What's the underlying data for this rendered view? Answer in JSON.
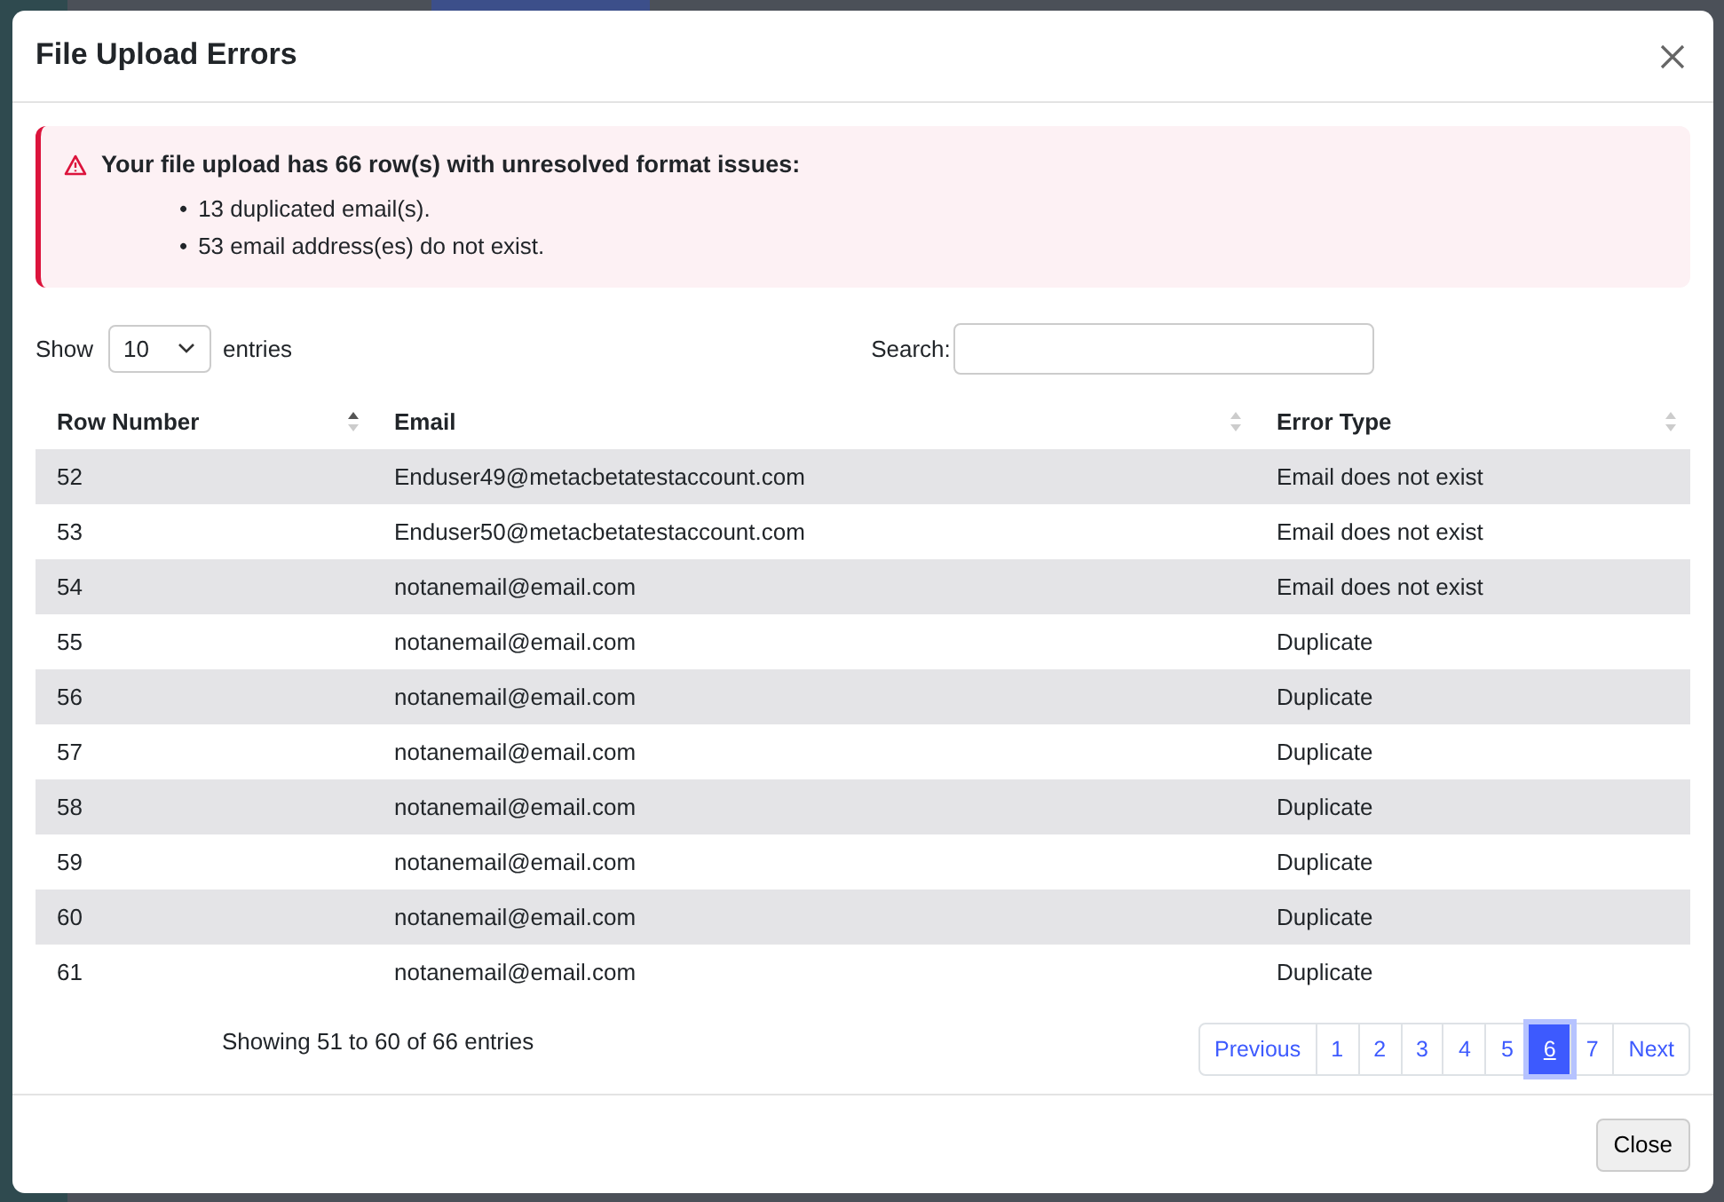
{
  "modal": {
    "title": "File Upload Errors"
  },
  "alert": {
    "heading": "Your file upload has 66 row(s) with unresolved format issues:",
    "items": [
      {
        "bullet": "•",
        "text": "13 duplicated email(s)."
      },
      {
        "bullet": "•",
        "text": "53 email address(es) do not exist."
      }
    ]
  },
  "length": {
    "show_label": "Show",
    "value": "10",
    "entries_label": "entries"
  },
  "search": {
    "label": "Search:"
  },
  "table": {
    "columns": [
      {
        "label": "Row Number",
        "sorted": true
      },
      {
        "label": "Email",
        "sorted": false
      },
      {
        "label": "Error Type",
        "sorted": false
      }
    ],
    "rows": [
      [
        "52",
        "Enduser49@metacbetatestaccount.com",
        "Email does not exist"
      ],
      [
        "53",
        "Enduser50@metacbetatestaccount.com",
        "Email does not exist"
      ],
      [
        "54",
        "notanemail@email.com",
        "Email does not exist"
      ],
      [
        "55",
        "notanemail@email.com",
        "Duplicate"
      ],
      [
        "56",
        "notanemail@email.com",
        "Duplicate"
      ],
      [
        "57",
        "notanemail@email.com",
        "Duplicate"
      ],
      [
        "58",
        "notanemail@email.com",
        "Duplicate"
      ],
      [
        "59",
        "notanemail@email.com",
        "Duplicate"
      ],
      [
        "60",
        "notanemail@email.com",
        "Duplicate"
      ],
      [
        "61",
        "notanemail@email.com",
        "Duplicate"
      ]
    ]
  },
  "info": "Showing 51 to 60 of 66 entries",
  "pagination": [
    {
      "label": "Previous",
      "selected": false
    },
    {
      "label": "1",
      "selected": false
    },
    {
      "label": "2",
      "selected": false
    },
    {
      "label": "3",
      "selected": false
    },
    {
      "label": "4",
      "selected": false
    },
    {
      "label": "5",
      "selected": false
    },
    {
      "label": "6",
      "selected": true
    },
    {
      "label": "7",
      "selected": false
    },
    {
      "label": "Next",
      "selected": false
    }
  ],
  "footer": {
    "close_button": "Close"
  }
}
